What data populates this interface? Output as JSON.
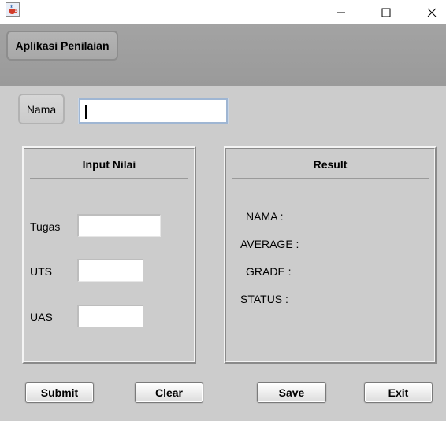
{
  "window": {
    "app_icon": "java-cup-icon",
    "controls": [
      "minimize-icon",
      "maximize-icon",
      "close-icon"
    ]
  },
  "header": {
    "app_title": "Aplikasi Penilaian"
  },
  "nama": {
    "label": "Nama",
    "value": ""
  },
  "input_panel": {
    "title": "Input Nilai",
    "fields": [
      {
        "label": "Tugas",
        "value": ""
      },
      {
        "label": "UTS",
        "value": ""
      },
      {
        "label": "UAS",
        "value": ""
      }
    ]
  },
  "result_panel": {
    "title": "Result",
    "rows": [
      "NAMA :",
      "AVERAGE :",
      "GRADE :",
      "STATUS :"
    ]
  },
  "buttons": {
    "submit": "Submit",
    "clear": "Clear",
    "save": "Save",
    "exit": "Exit"
  }
}
